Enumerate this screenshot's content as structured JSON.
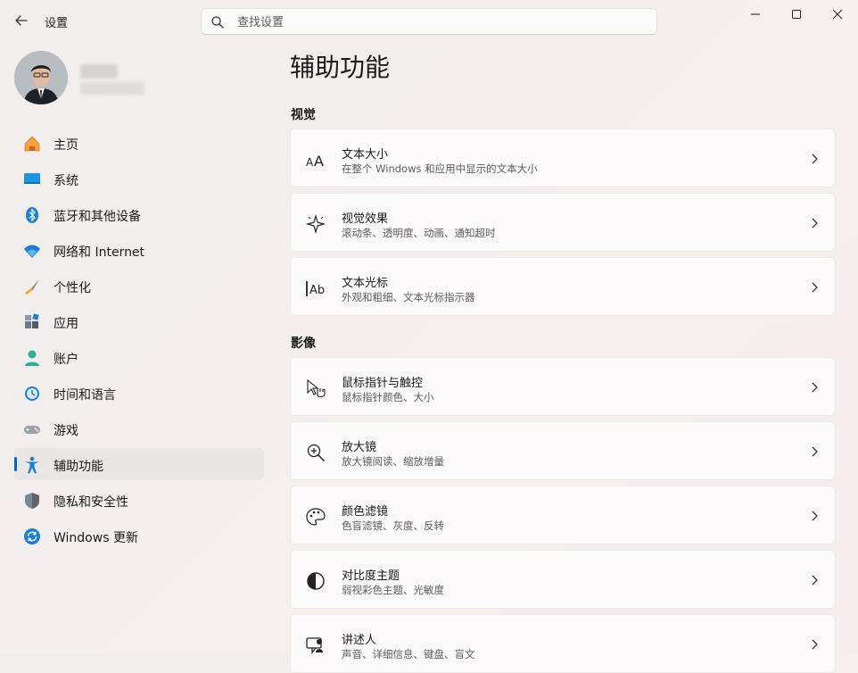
{
  "app": {
    "title": "设置"
  },
  "search": {
    "placeholder": "查找设置",
    "value": ""
  },
  "nav": {
    "items": [
      {
        "label": "主页",
        "icon": "home-icon",
        "active": false
      },
      {
        "label": "系统",
        "icon": "system-icon",
        "active": false
      },
      {
        "label": "蓝牙和其他设备",
        "icon": "bluetooth-icon",
        "active": false
      },
      {
        "label": "网络和 Internet",
        "icon": "wifi-icon",
        "active": false
      },
      {
        "label": "个性化",
        "icon": "brush-icon",
        "active": false
      },
      {
        "label": "应用",
        "icon": "apps-icon",
        "active": false
      },
      {
        "label": "账户",
        "icon": "account-icon",
        "active": false
      },
      {
        "label": "时间和语言",
        "icon": "time-language-icon",
        "active": false
      },
      {
        "label": "游戏",
        "icon": "gamepad-icon",
        "active": false
      },
      {
        "label": "辅助功能",
        "icon": "accessibility-icon",
        "active": true
      },
      {
        "label": "隐私和安全性",
        "icon": "shield-icon",
        "active": false
      },
      {
        "label": "Windows 更新",
        "icon": "update-icon",
        "active": false
      }
    ]
  },
  "main": {
    "title": "辅助功能",
    "sections": [
      {
        "heading": "视觉",
        "cards": [
          {
            "title": "文本大小",
            "subtitle": "在整个 Windows 和应用中显示的文本大小",
            "icon": "text-size-icon"
          },
          {
            "title": "视觉效果",
            "subtitle": "滚动条、透明度、动画、通知超时",
            "icon": "visual-effects-icon"
          },
          {
            "title": "文本光标",
            "subtitle": "外观和粗细、文本光标指示器",
            "icon": "text-cursor-icon"
          }
        ]
      },
      {
        "heading": "影像",
        "cards": [
          {
            "title": "鼠标指针与触控",
            "subtitle": "鼠标指针颜色、大小",
            "icon": "mouse-pointer-icon"
          },
          {
            "title": "放大镜",
            "subtitle": "放大镜阅读、缩放增量",
            "icon": "magnifier-icon"
          },
          {
            "title": "颜色滤镜",
            "subtitle": "色盲滤镜、灰度、反转",
            "icon": "palette-icon"
          },
          {
            "title": "对比度主题",
            "subtitle": "弱视彩色主题、光敏度",
            "icon": "contrast-icon"
          },
          {
            "title": "讲述人",
            "subtitle": "声音、详细信息、键盘、盲文",
            "icon": "narrator-icon"
          }
        ]
      }
    ]
  },
  "colors": {
    "accent": "#0067c0",
    "background": "#f3efef",
    "card": "#fbf9f9"
  }
}
